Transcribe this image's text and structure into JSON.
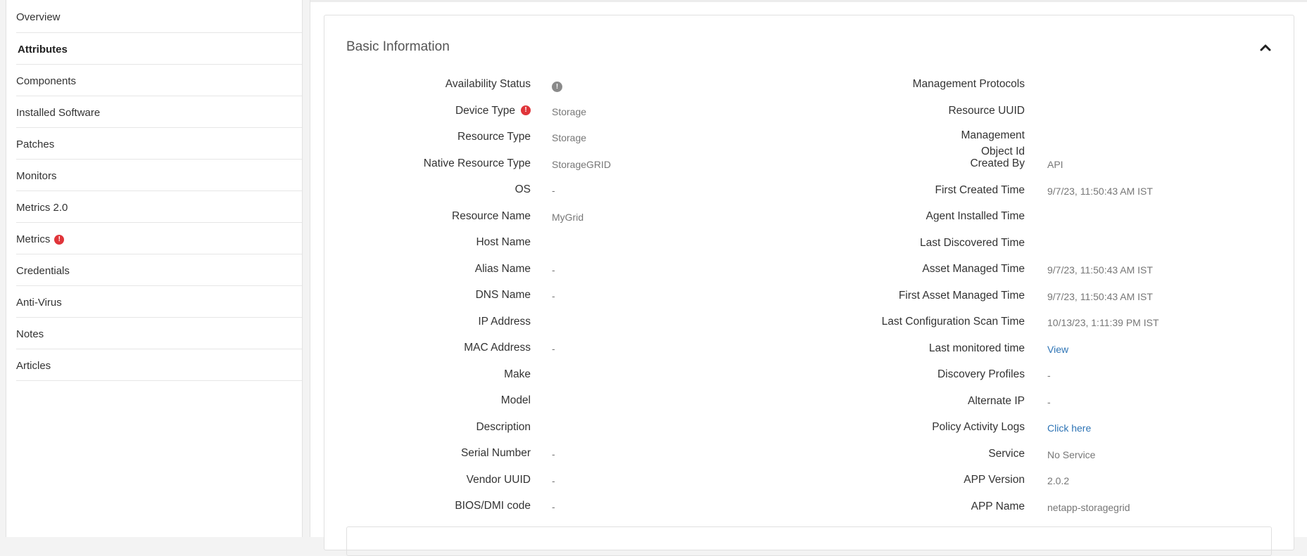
{
  "sidebar": {
    "items": [
      {
        "label": "Overview"
      },
      {
        "label": "Attributes"
      },
      {
        "label": "Components"
      },
      {
        "label": "Installed Software"
      },
      {
        "label": "Patches"
      },
      {
        "label": "Monitors"
      },
      {
        "label": "Metrics 2.0"
      },
      {
        "label": "Metrics",
        "alert": "!"
      },
      {
        "label": "Credentials"
      },
      {
        "label": "Anti-Virus"
      },
      {
        "label": "Notes"
      },
      {
        "label": "Articles"
      }
    ],
    "active_index": 1
  },
  "panel": {
    "title": "Basic Information"
  },
  "left_fields": [
    {
      "label": "Availability Status",
      "value": ""
    },
    {
      "label": "Device Type",
      "value": "Storage"
    },
    {
      "label": "Resource Type",
      "value": "Storage"
    },
    {
      "label": "Native Resource Type",
      "value": "StorageGRID"
    },
    {
      "label": "OS",
      "value": "-"
    },
    {
      "label": "Resource Name",
      "value": "MyGrid"
    },
    {
      "label": "Host Name",
      "value": ""
    },
    {
      "label": "Alias Name",
      "value": "-"
    },
    {
      "label": "DNS Name",
      "value": "-"
    },
    {
      "label": "IP Address",
      "value": ""
    },
    {
      "label": "MAC Address",
      "value": "-"
    },
    {
      "label": "Make",
      "value": ""
    },
    {
      "label": "Model",
      "value": ""
    },
    {
      "label": "Description",
      "value": ""
    },
    {
      "label": "Serial Number",
      "value": "-"
    },
    {
      "label": "Vendor UUID",
      "value": "-"
    },
    {
      "label": "BIOS/DMI code",
      "value": "-"
    }
  ],
  "right_fields": [
    {
      "label": "Management Protocols",
      "value": ""
    },
    {
      "label": "Resource UUID",
      "value": ""
    },
    {
      "label": "Management",
      "label2": "Object Id",
      "value": ""
    },
    {
      "label": "Created By",
      "value": "API"
    },
    {
      "label": "First Created Time",
      "value": "9/7/23, 11:50:43 AM IST"
    },
    {
      "label": "Agent Installed Time",
      "value": ""
    },
    {
      "label": "Last Discovered Time",
      "value": ""
    },
    {
      "label": "Asset Managed Time",
      "value": "9/7/23, 11:50:43 AM IST"
    },
    {
      "label": "First Asset Managed Time",
      "value": "9/7/23, 11:50:43 AM IST"
    },
    {
      "label": "Last Configuration Scan Time",
      "value": "10/13/23, 1:11:39 PM IST"
    },
    {
      "label": "Last monitored time",
      "link": "View"
    },
    {
      "label": "Discovery Profiles",
      "value": "-"
    },
    {
      "label": "Alternate IP",
      "value": "-"
    },
    {
      "label": "Policy Activity Logs",
      "link": "Click here"
    },
    {
      "label": "Service",
      "value": "No Service"
    },
    {
      "label": "APP Version",
      "value": "2.0.2"
    },
    {
      "label": "APP Name",
      "value": "netapp-storagegrid"
    }
  ],
  "icons": {
    "availability_status": "info-icon",
    "device_type_alert": "!",
    "collapse": "chevron-up-icon"
  },
  "colors": {
    "alert": "#e0353a",
    "link": "#2e74b5"
  }
}
